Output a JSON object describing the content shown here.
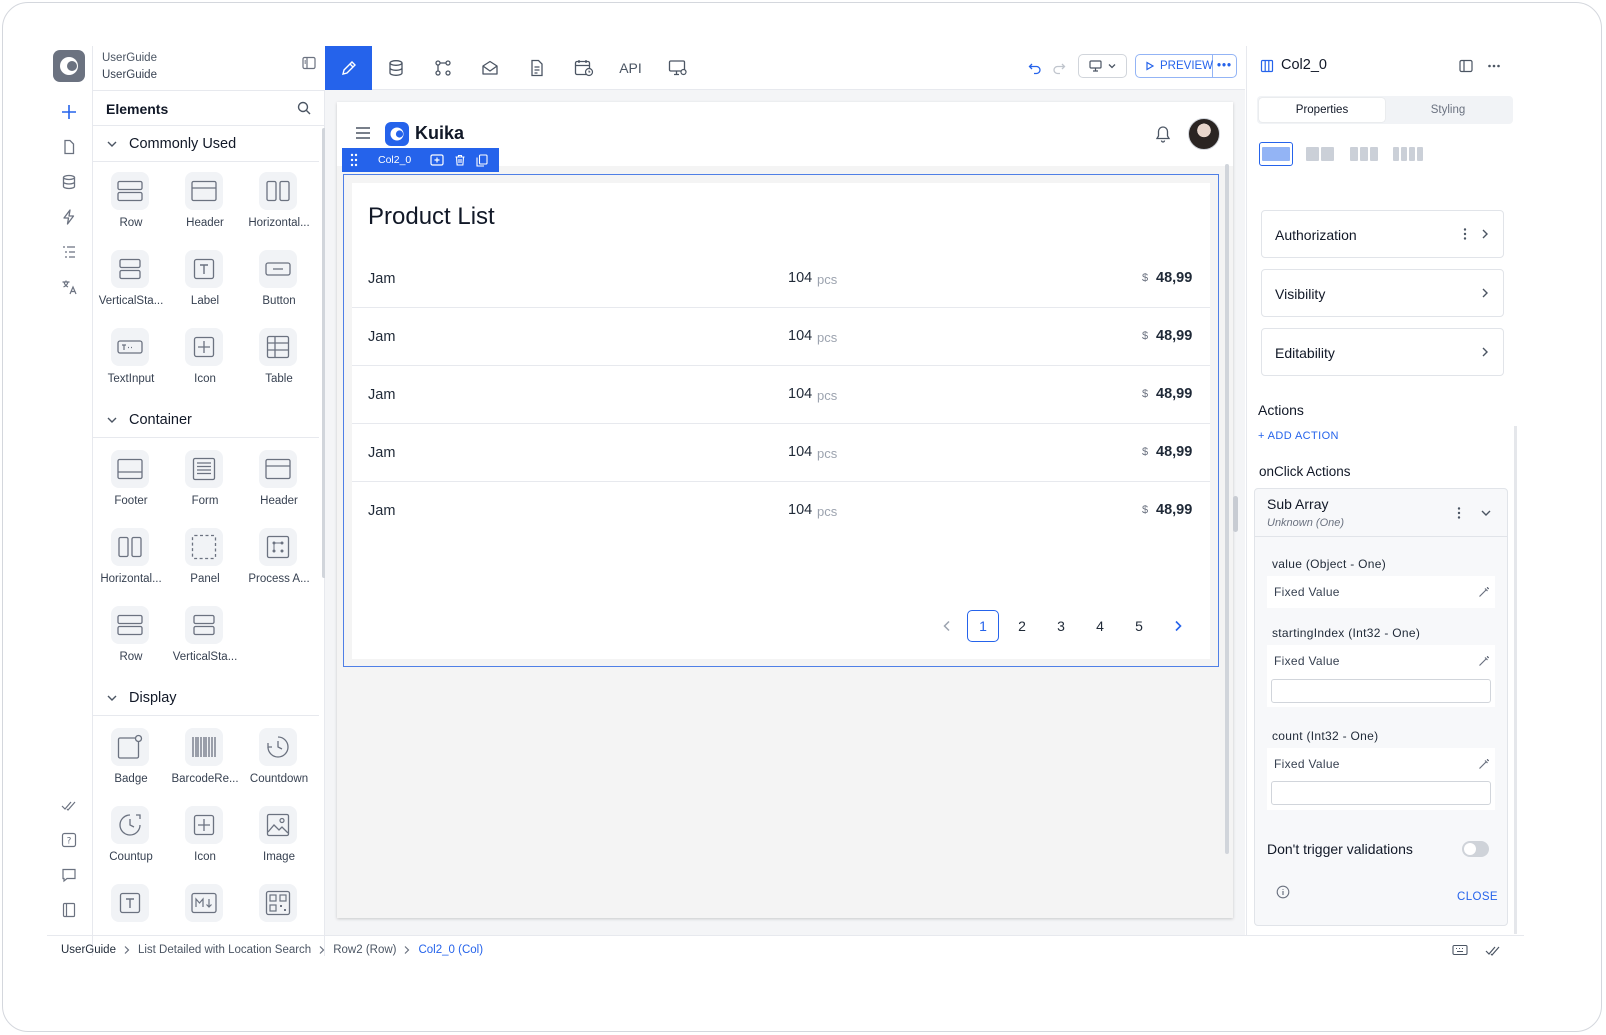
{
  "project": {
    "workspace": "UserGuide",
    "app": "UserGuide"
  },
  "toolbar": {
    "api_label": "API",
    "preview_label": "PREVIEW",
    "more_label": "•••"
  },
  "elements_panel": {
    "title": "Elements",
    "sections": [
      {
        "title": "Commonly Used",
        "items": [
          {
            "label": "Row",
            "icon": "row-icon"
          },
          {
            "label": "Header",
            "icon": "header-icon"
          },
          {
            "label": "Horizontal...",
            "icon": "horizontal-stack-icon"
          },
          {
            "label": "VerticalSta...",
            "icon": "vertical-stack-icon"
          },
          {
            "label": "Label",
            "icon": "label-icon"
          },
          {
            "label": "Button",
            "icon": "button-icon"
          },
          {
            "label": "TextInput",
            "icon": "text-input-icon"
          },
          {
            "label": "Icon",
            "icon": "plus-box-icon"
          },
          {
            "label": "Table",
            "icon": "table-icon"
          }
        ]
      },
      {
        "title": "Container",
        "items": [
          {
            "label": "Footer",
            "icon": "footer-icon"
          },
          {
            "label": "Form",
            "icon": "form-icon"
          },
          {
            "label": "Header",
            "icon": "header-icon"
          },
          {
            "label": "Horizontal...",
            "icon": "horizontal-stack-icon"
          },
          {
            "label": "Panel",
            "icon": "panel-icon"
          },
          {
            "label": "Process A...",
            "icon": "process-icon"
          },
          {
            "label": "Row",
            "icon": "row-icon"
          },
          {
            "label": "VerticalSta...",
            "icon": "vertical-stack-icon"
          }
        ]
      },
      {
        "title": "Display",
        "items": [
          {
            "label": "Badge",
            "icon": "badge-icon"
          },
          {
            "label": "BarcodeRe...",
            "icon": "barcode-icon"
          },
          {
            "label": "Countdown",
            "icon": "countdown-icon"
          },
          {
            "label": "Countup",
            "icon": "countup-icon"
          },
          {
            "label": "Icon",
            "icon": "plus-box-icon"
          },
          {
            "label": "Image",
            "icon": "image-icon"
          },
          {
            "label": "",
            "icon": "text-icon"
          },
          {
            "label": "",
            "icon": "markdown-icon"
          },
          {
            "label": "",
            "icon": "qr-icon"
          }
        ]
      }
    ]
  },
  "canvas": {
    "brand": "Kuika",
    "selected_tag": "Col2_0",
    "card_title": "Product List",
    "rows": [
      {
        "name": "Jam",
        "qty": "104",
        "unit": "pcs",
        "currency": "$",
        "price": "48,99"
      },
      {
        "name": "Jam",
        "qty": "104",
        "unit": "pcs",
        "currency": "$",
        "price": "48,99"
      },
      {
        "name": "Jam",
        "qty": "104",
        "unit": "pcs",
        "currency": "$",
        "price": "48,99"
      },
      {
        "name": "Jam",
        "qty": "104",
        "unit": "pcs",
        "currency": "$",
        "price": "48,99"
      },
      {
        "name": "Jam",
        "qty": "104",
        "unit": "pcs",
        "currency": "$",
        "price": "48,99"
      }
    ],
    "pages": [
      "1",
      "2",
      "3",
      "4",
      "5"
    ],
    "active_page": "1"
  },
  "right_panel": {
    "title": "Col2_0",
    "tabs": [
      "Properties",
      "Styling"
    ],
    "accordions": [
      "Authorization",
      "Visibility",
      "Editability"
    ],
    "actions_title": "Actions",
    "add_action": "+ ADD ACTION",
    "onclick_title": "onClick Actions",
    "sub": {
      "title": "Sub Array",
      "subtitle": "Unknown (One)",
      "params": [
        {
          "label": "value (Object - One)",
          "mode": "Fixed Value"
        },
        {
          "label": "startingIndex (Int32 - One)",
          "mode": "Fixed Value",
          "value": ""
        },
        {
          "label": "count (Int32 - One)",
          "mode": "Fixed Value",
          "value": ""
        }
      ],
      "toggle_label": "Don't trigger validations",
      "toggle_on": false,
      "close_label": "CLOSE"
    }
  },
  "breadcrumb": [
    "UserGuide",
    "List Detailed with Location Search",
    "Row2 (Row)",
    "Col2_0 (Col)"
  ],
  "colors": {
    "accent": "#2563eb",
    "canvas_bg": "#f4f5f7"
  }
}
